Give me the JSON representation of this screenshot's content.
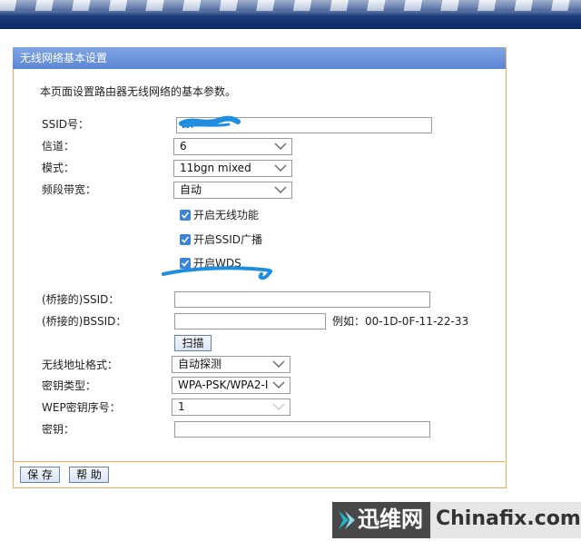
{
  "panel_title": "无线网络基本设置",
  "description": "本页面设置路由器无线网络的基本参数。",
  "fields": {
    "ssid": {
      "label": "SSID号：",
      "value": "WI"
    },
    "channel": {
      "label": "信道：",
      "value": "6"
    },
    "mode": {
      "label": "模式：",
      "value": "11bgn mixed"
    },
    "bandwidth": {
      "label": "频段带宽：",
      "value": "自动"
    },
    "bridge_ssid": {
      "label": "(桥接的)SSID：",
      "value": ""
    },
    "bridge_bssid": {
      "label": "(桥接的)BSSID：",
      "value": "",
      "example": "例如：00-1D-0F-11-22-33"
    },
    "addr_format": {
      "label": "无线地址格式：",
      "value": "自动探测"
    },
    "key_type": {
      "label": "密钥类型：",
      "value": "WPA-PSK/WPA2-I"
    },
    "wep_index": {
      "label": "WEP密钥序号：",
      "value": "1"
    },
    "key": {
      "label": "密钥：",
      "value": ""
    }
  },
  "checkboxes": {
    "wireless": {
      "label": "开启无线功能",
      "checked": true
    },
    "ssid_broadcast": {
      "label": "开启SSID广播",
      "checked": true
    },
    "wds": {
      "label": "开启WDS",
      "checked": true
    }
  },
  "buttons": {
    "scan": "扫描",
    "save": "保 存",
    "help": "帮 助"
  },
  "watermark": {
    "cn": "迅维网",
    "en": "Chinafix.com"
  },
  "colors": {
    "title_bar": "#5b86d6",
    "panel_border": "#f0a860",
    "checkbox": "#3d83d6",
    "annotation": "#1f8ee0"
  },
  "icons": {
    "dropdown": "chevron-down-icon",
    "checkbox": "checkmark-icon",
    "watermark": "arrow-logo-icon"
  }
}
